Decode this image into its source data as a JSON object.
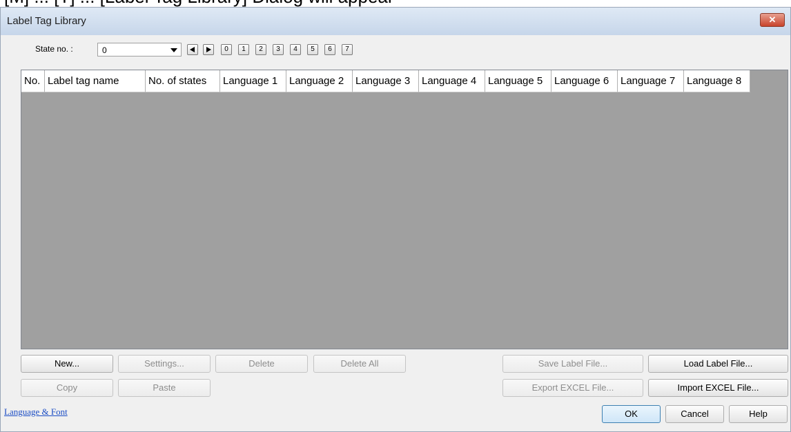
{
  "top_strip": "[M] ... [T] ... [Label Tag Library] Dialog will appear",
  "window": {
    "title": "Label Tag Library",
    "close_icon": "close-x-icon",
    "close_symbol": "✕"
  },
  "state": {
    "label": "State no. :",
    "value": "0",
    "buttons": [
      "0",
      "1",
      "2",
      "3",
      "4",
      "5",
      "6",
      "7"
    ]
  },
  "table": {
    "columns": [
      "No.",
      "Label tag name",
      "No. of states",
      "Language 1",
      "Language 2",
      "Language 3",
      "Language 4",
      "Language 5",
      "Language 6",
      "Language 7",
      "Language 8"
    ],
    "rows": []
  },
  "buttons": {
    "new": "New...",
    "settings": "Settings...",
    "delete": "Delete",
    "delete_all": "Delete All",
    "copy": "Copy",
    "paste": "Paste",
    "save_label": "Save Label File...",
    "load_label": "Load Label File...",
    "export_excel": "Export EXCEL File...",
    "import_excel": "Import EXCEL File...",
    "ok": "OK",
    "cancel": "Cancel",
    "help": "Help"
  },
  "language_font_link": "Language & Font"
}
